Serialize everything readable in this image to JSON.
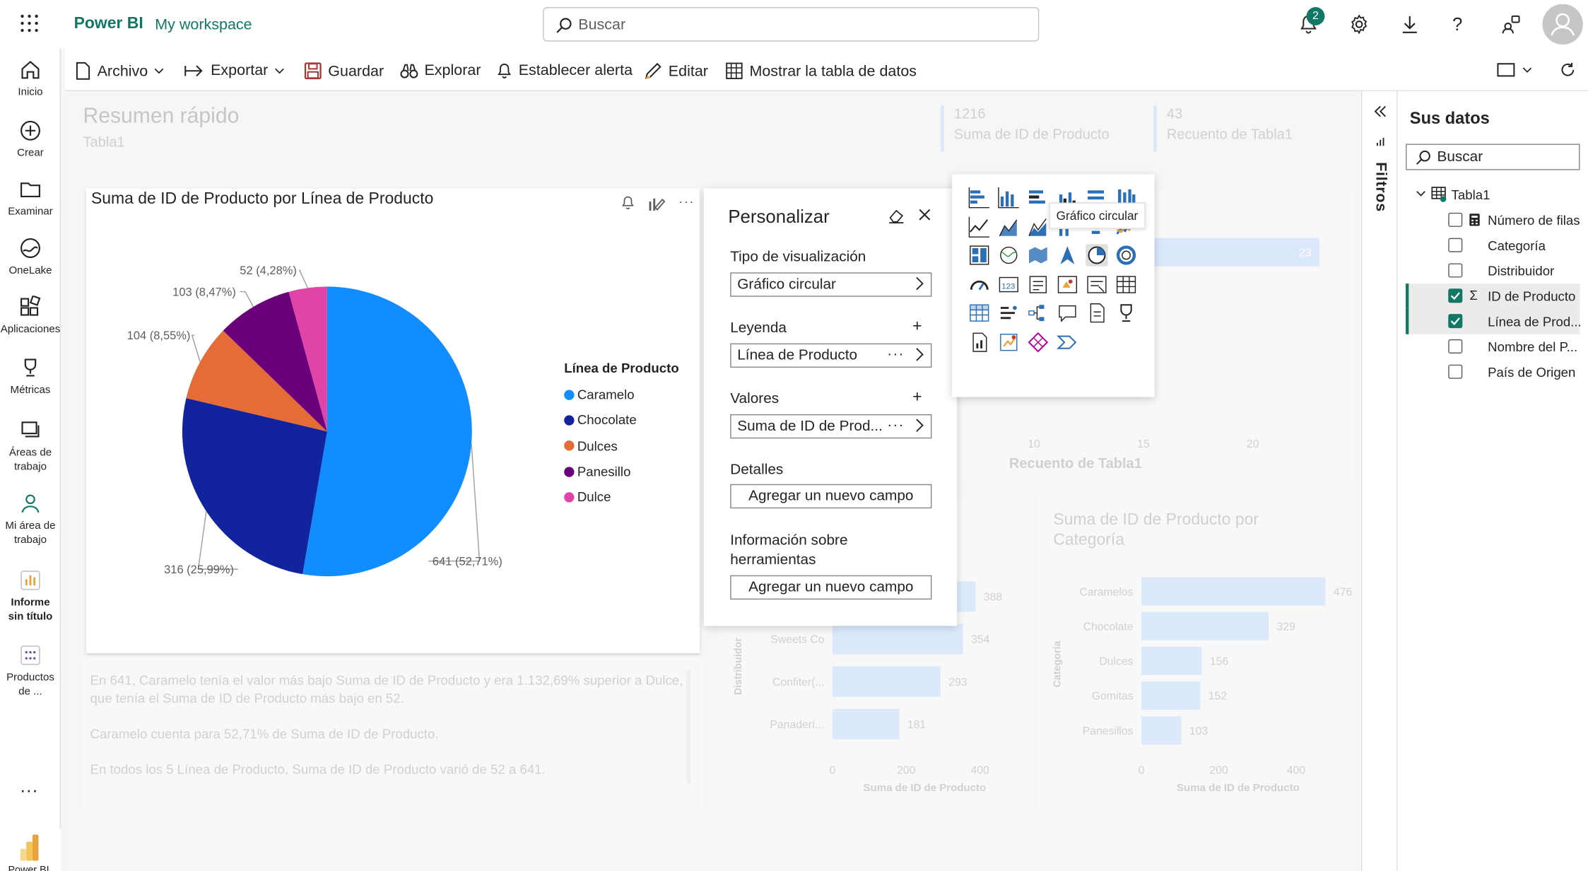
{
  "topbar": {
    "brand": "Power BI",
    "workspace": "My workspace",
    "search_placeholder": "Buscar",
    "notifications_count": "2"
  },
  "nav": [
    {
      "label": "Inicio"
    },
    {
      "label": "Crear"
    },
    {
      "label": "Examinar"
    },
    {
      "label": "OneLake"
    },
    {
      "label": "Aplicaciones"
    },
    {
      "label": "Métricas"
    },
    {
      "label": "Áreas de trabajo"
    },
    {
      "label": "Mi área de trabajo"
    },
    {
      "label": "Informe sin título"
    },
    {
      "label": "Productos de ..."
    }
  ],
  "nav_more": "...",
  "nav_logo_label": "Power BI",
  "ribbon": {
    "archivo": "Archivo",
    "exportar": "Exportar",
    "guardar": "Guardar",
    "explorar": "Explorar",
    "alerta": "Establecer alerta",
    "editar": "Editar",
    "tabla": "Mostrar la tabla de datos"
  },
  "quick_summary": {
    "title": "Resumen rápido",
    "subtitle": "Tabla1",
    "kpis": [
      {
        "value": "1216",
        "label": "Suma de ID de Producto"
      },
      {
        "value": "43",
        "label": "Recuento de Tabla1"
      }
    ]
  },
  "chart_data": [
    {
      "type": "pie",
      "title": "Suma de ID de Producto por Línea de Producto",
      "legend_title": "Línea de Producto",
      "legend_position": "right",
      "categories": [
        "Caramelo",
        "Chocolate",
        "Dulces",
        "Panesillo",
        "Dulce"
      ],
      "values": [
        641,
        316,
        104,
        103,
        52
      ],
      "data_labels": [
        "641 (52,71%)",
        "316 (25,99%)",
        "104 (8,55%)",
        "103 (8,47%)",
        "52 (4,28%)"
      ],
      "colors": [
        "#118dff",
        "#12239e",
        "#e66c37",
        "#6b007b",
        "#e044a7"
      ]
    },
    {
      "type": "bar",
      "title": "Suma de ID de Producto por Categoría",
      "categories": [
        "Caramelos",
        "Chocolate",
        "Dulces",
        "Gomitas",
        "Panesillos"
      ],
      "values": [
        476,
        329,
        156,
        152,
        103
      ],
      "xlabel": "Suma de ID de Producto",
      "ylabel": "Categoría",
      "xticks": [
        "0",
        "200",
        "400"
      ],
      "xlim": [
        0,
        500
      ]
    },
    {
      "type": "bar",
      "title": "",
      "categories": [
        "",
        "Sweets Co",
        "Confiter(...",
        "Panaderí..."
      ],
      "values": [
        388,
        354,
        293,
        181
      ],
      "data_labels": [
        "388",
        "354",
        "293",
        "181"
      ],
      "xlabel": "Suma de ID de Producto",
      "ylabel": "Distribuidor",
      "xticks": [
        "0",
        "200",
        "400"
      ],
      "xlim": [
        0,
        500
      ]
    },
    {
      "type": "bar",
      "title": "",
      "values": [
        23
      ],
      "xlabel": "Recuento de Tabla1",
      "xticks": [
        "10",
        "15",
        "20"
      ]
    }
  ],
  "insights": [
    "En 641, Caramelo tenía el valor más bajo Suma de ID de Producto y era 1.132,69% superior a Dulce, que tenía el Suma de ID de Producto más bajo en 52.",
    "Caramelo cuenta para 52,71% de Suma de ID de Producto.",
    "En todos los 5 Línea de Producto, Suma de ID de Producto varió de 52 a 641."
  ],
  "customize": {
    "title": "Personalizar",
    "viz_type_label": "Tipo de visualización",
    "viz_type_value": "Gráfico circular",
    "legend_label": "Leyenda",
    "legend_value": "Línea de Producto",
    "values_label": "Valores",
    "values_value": "Suma de ID de Prod...",
    "details_label": "Detalles",
    "details_add": "Agregar un nuevo campo",
    "tooltips_label_1": "Información sobre",
    "tooltips_label_2": "herramientas",
    "tooltips_add": "Agregar un nuevo campo"
  },
  "viz_tooltip": "Gráfico circular",
  "filters_label": "Filtros",
  "data_pane": {
    "title": "Sus datos",
    "search_placeholder": "Buscar",
    "table_name": "Tabla1",
    "fields": [
      {
        "label": "Número de filas",
        "checked": false
      },
      {
        "label": "Categoría",
        "checked": false
      },
      {
        "label": "Distribuidor",
        "checked": false
      },
      {
        "label": "ID de Producto",
        "checked": true
      },
      {
        "label": "Línea de Prod...",
        "checked": true
      },
      {
        "label": "Nombre del P...",
        "checked": false
      },
      {
        "label": "País de Origen",
        "checked": false
      }
    ]
  }
}
